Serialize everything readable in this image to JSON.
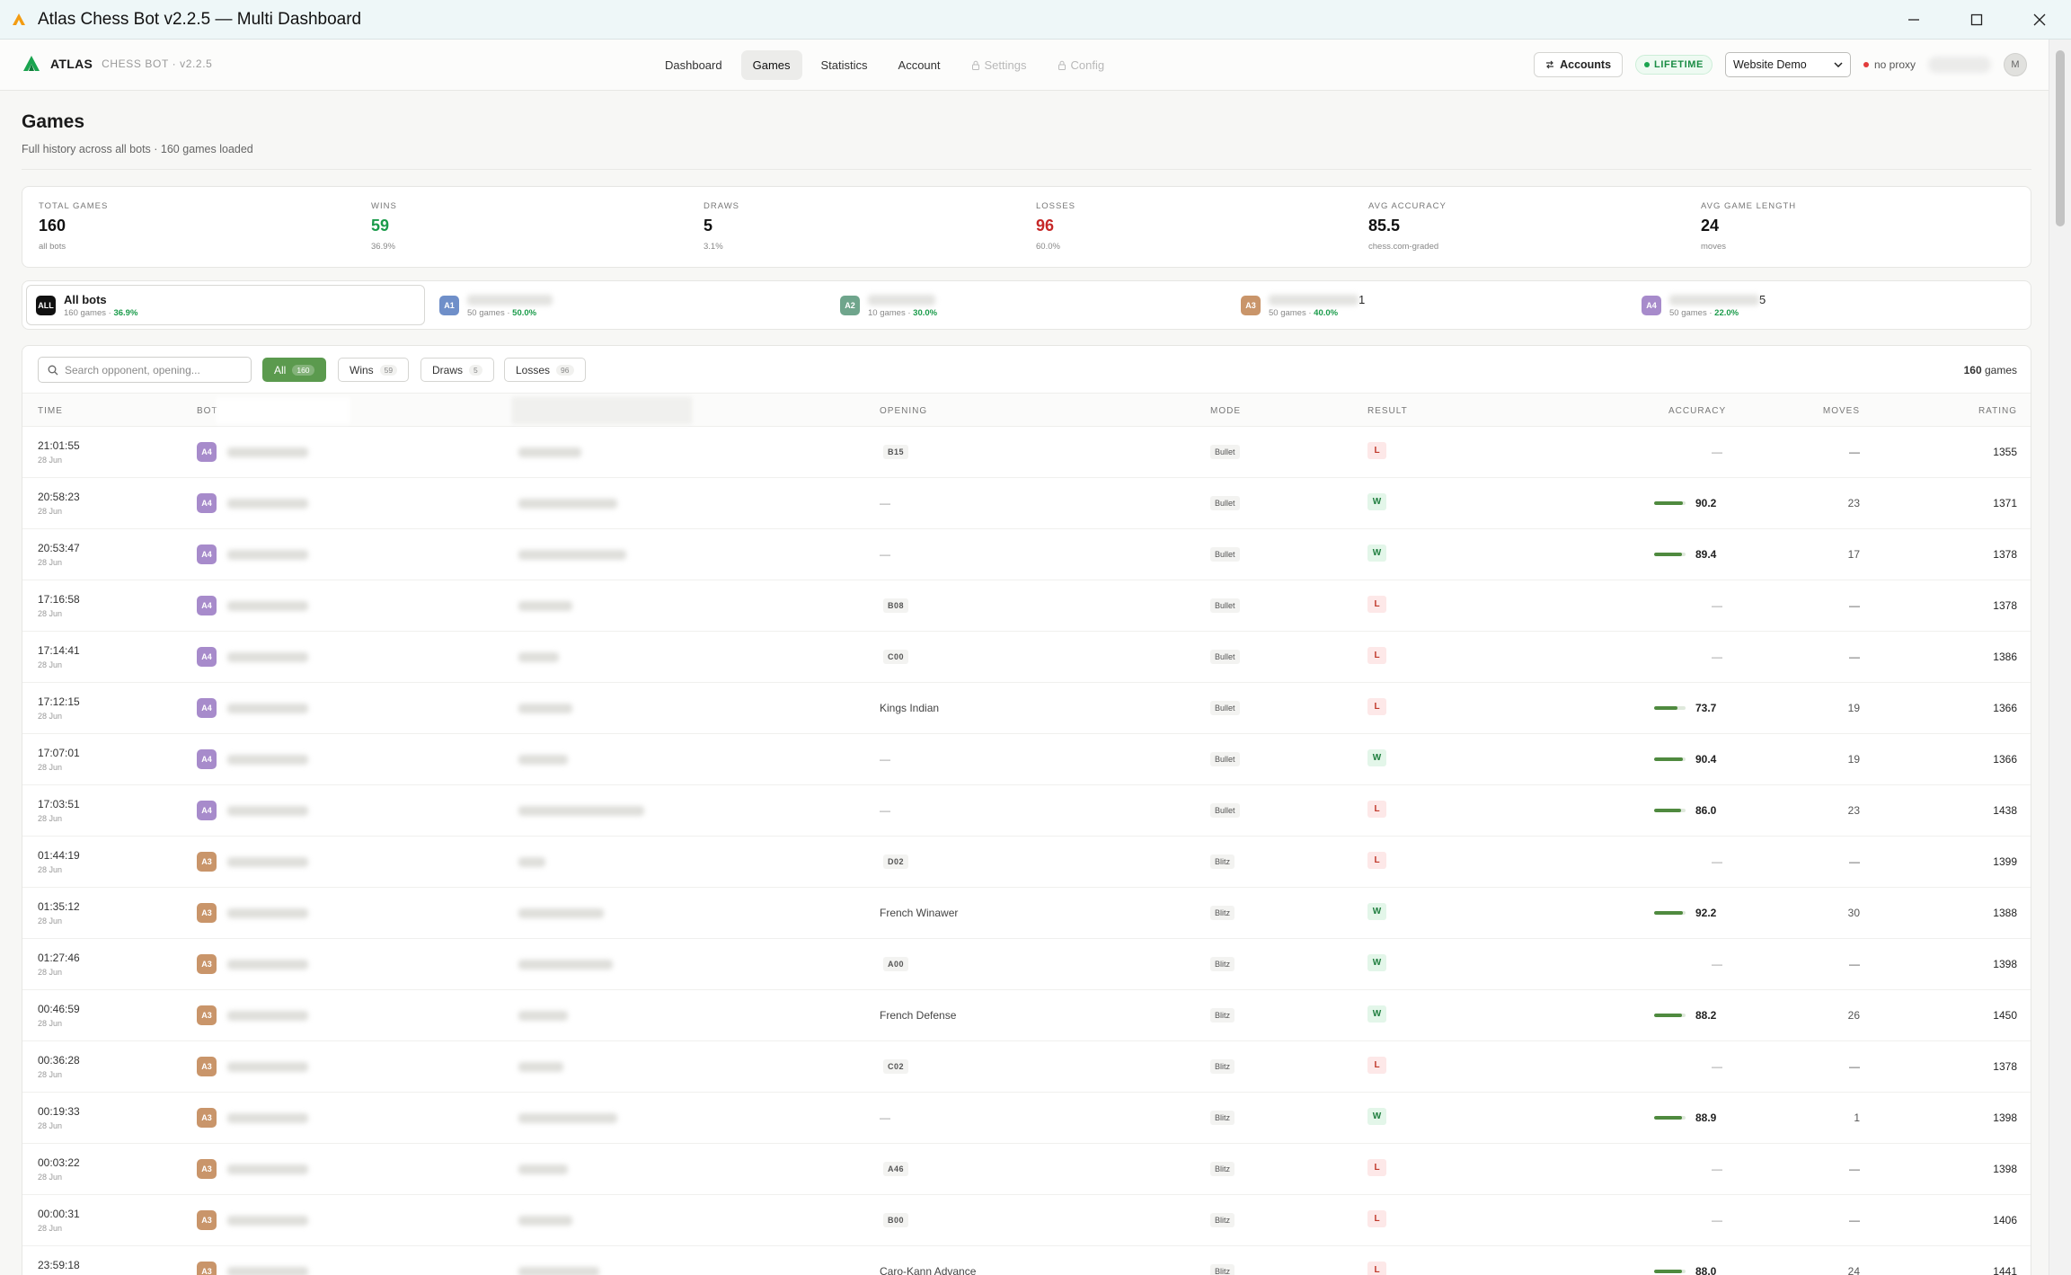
{
  "window": {
    "title": "Atlas Chess Bot v2.2.5 — Multi Dashboard"
  },
  "brand": {
    "name": "ATLAS",
    "sub": "CHESS BOT · v2.2.5",
    "color": "#1aa44f"
  },
  "nav": {
    "items": [
      {
        "label": "Dashboard",
        "locked": false,
        "active": false
      },
      {
        "label": "Games",
        "locked": false,
        "active": true
      },
      {
        "label": "Statistics",
        "locked": false,
        "active": false
      },
      {
        "label": "Account",
        "locked": false,
        "active": false
      },
      {
        "label": "Settings",
        "locked": true,
        "active": false
      },
      {
        "label": "Config",
        "locked": true,
        "active": false
      }
    ]
  },
  "toolbar": {
    "accounts_label": "Accounts",
    "lifetime_label": "LIFETIME",
    "profile_select": "Website Demo",
    "proxy_label": "no proxy",
    "avatar_initial": "M"
  },
  "page": {
    "title": "Games",
    "subtitle": "Full history across all bots · 160 games loaded"
  },
  "stats": [
    {
      "label": "TOTAL GAMES",
      "value": "160",
      "sub": "all bots",
      "color": "#111111"
    },
    {
      "label": "WINS",
      "value": "59",
      "sub": "36.9%",
      "color": "#1a9b4a"
    },
    {
      "label": "DRAWS",
      "value": "5",
      "sub": "3.1%",
      "color": "#111111"
    },
    {
      "label": "LOSSES",
      "value": "96",
      "sub": "60.0%",
      "color": "#c62828"
    },
    {
      "label": "AVG ACCURACY",
      "value": "85.5",
      "sub": "chess.com-graded",
      "color": "#111111"
    },
    {
      "label": "AVG GAME LENGTH",
      "value": "24",
      "sub": "moves",
      "color": "#111111"
    }
  ],
  "bots": {
    "all": {
      "badge": "ALL",
      "name": "All bots",
      "games": "160 games ·",
      "pct": "36.9%"
    },
    "items": [
      {
        "badge": "A1",
        "color": "#6f8fc9",
        "suffix": "",
        "games": "50 games ·",
        "pct": "50.0%"
      },
      {
        "badge": "A2",
        "color": "#6fa58c",
        "suffix": "",
        "games": "10 games ·",
        "pct": "30.0%"
      },
      {
        "badge": "A3",
        "color": "#c9956a",
        "suffix": "1",
        "games": "50 games ·",
        "pct": "40.0%"
      },
      {
        "badge": "A4",
        "color": "#a78bcb",
        "suffix": "5",
        "games": "50 games ·",
        "pct": "22.0%"
      }
    ]
  },
  "search": {
    "placeholder": "Search opponent, opening..."
  },
  "filters": [
    {
      "label": "All",
      "count": "160",
      "active": true
    },
    {
      "label": "Wins",
      "count": "59",
      "active": false
    },
    {
      "label": "Draws",
      "count": "5",
      "active": false
    },
    {
      "label": "Losses",
      "count": "96",
      "active": false
    }
  ],
  "table": {
    "count": "160",
    "count_suffix": "games",
    "columns": {
      "time": "TIME",
      "bot": "BOT",
      "opening": "OPENING",
      "mode": "MODE",
      "result": "RESULT",
      "accuracy": "ACCURACY",
      "moves": "MOVES",
      "rating": "RATING"
    },
    "rows": [
      {
        "time": "21:01:55",
        "date": "28 Jun",
        "bot": "A4",
        "opening": "B15",
        "eco": true,
        "mode": "Bullet",
        "result": "L",
        "accuracy": null,
        "moves": "—",
        "rating": "1355"
      },
      {
        "time": "20:58:23",
        "date": "28 Jun",
        "bot": "A4",
        "opening": "—",
        "eco": false,
        "mode": "Bullet",
        "result": "W",
        "accuracy": "90.2",
        "moves": "23",
        "rating": "1371"
      },
      {
        "time": "20:53:47",
        "date": "28 Jun",
        "bot": "A4",
        "opening": "—",
        "eco": false,
        "mode": "Bullet",
        "result": "W",
        "accuracy": "89.4",
        "moves": "17",
        "rating": "1378"
      },
      {
        "time": "17:16:58",
        "date": "28 Jun",
        "bot": "A4",
        "opening": "B08",
        "eco": true,
        "mode": "Bullet",
        "result": "L",
        "accuracy": null,
        "moves": "—",
        "rating": "1378"
      },
      {
        "time": "17:14:41",
        "date": "28 Jun",
        "bot": "A4",
        "opening": "C00",
        "eco": true,
        "mode": "Bullet",
        "result": "L",
        "accuracy": null,
        "moves": "—",
        "rating": "1386"
      },
      {
        "time": "17:12:15",
        "date": "28 Jun",
        "bot": "A4",
        "opening": "Kings Indian",
        "eco": false,
        "mode": "Bullet",
        "result": "L",
        "accuracy": "73.7",
        "moves": "19",
        "rating": "1366"
      },
      {
        "time": "17:07:01",
        "date": "28 Jun",
        "bot": "A4",
        "opening": "—",
        "eco": false,
        "mode": "Bullet",
        "result": "W",
        "accuracy": "90.4",
        "moves": "19",
        "rating": "1366"
      },
      {
        "time": "17:03:51",
        "date": "28 Jun",
        "bot": "A4",
        "opening": "—",
        "eco": false,
        "mode": "Bullet",
        "result": "L",
        "accuracy": "86.0",
        "moves": "23",
        "rating": "1438"
      },
      {
        "time": "01:44:19",
        "date": "28 Jun",
        "bot": "A3",
        "opening": "D02",
        "eco": true,
        "mode": "Blitz",
        "result": "L",
        "accuracy": null,
        "moves": "—",
        "rating": "1399"
      },
      {
        "time": "01:35:12",
        "date": "28 Jun",
        "bot": "A3",
        "opening": "French Winawer",
        "eco": false,
        "mode": "Blitz",
        "result": "W",
        "accuracy": "92.2",
        "moves": "30",
        "rating": "1388"
      },
      {
        "time": "01:27:46",
        "date": "28 Jun",
        "bot": "A3",
        "opening": "A00",
        "eco": true,
        "mode": "Blitz",
        "result": "W",
        "accuracy": null,
        "moves": "—",
        "rating": "1398"
      },
      {
        "time": "00:46:59",
        "date": "28 Jun",
        "bot": "A3",
        "opening": "French Defense",
        "eco": false,
        "mode": "Blitz",
        "result": "W",
        "accuracy": "88.2",
        "moves": "26",
        "rating": "1450"
      },
      {
        "time": "00:36:28",
        "date": "28 Jun",
        "bot": "A3",
        "opening": "C02",
        "eco": true,
        "mode": "Blitz",
        "result": "L",
        "accuracy": null,
        "moves": "—",
        "rating": "1378"
      },
      {
        "time": "00:19:33",
        "date": "28 Jun",
        "bot": "A3",
        "opening": "—",
        "eco": false,
        "mode": "Blitz",
        "result": "W",
        "accuracy": "88.9",
        "moves": "1",
        "rating": "1398"
      },
      {
        "time": "00:03:22",
        "date": "28 Jun",
        "bot": "A3",
        "opening": "A46",
        "eco": true,
        "mode": "Blitz",
        "result": "L",
        "accuracy": null,
        "moves": "—",
        "rating": "1398"
      },
      {
        "time": "00:00:31",
        "date": "28 Jun",
        "bot": "A3",
        "opening": "B00",
        "eco": true,
        "mode": "Blitz",
        "result": "L",
        "accuracy": null,
        "moves": "—",
        "rating": "1406"
      },
      {
        "time": "23:59:18",
        "date": "",
        "bot": "A3",
        "opening": "Caro-Kann Advance",
        "eco": false,
        "mode": "Blitz",
        "result": "L",
        "accuracy": "88.0",
        "moves": "24",
        "rating": "1441"
      }
    ]
  }
}
